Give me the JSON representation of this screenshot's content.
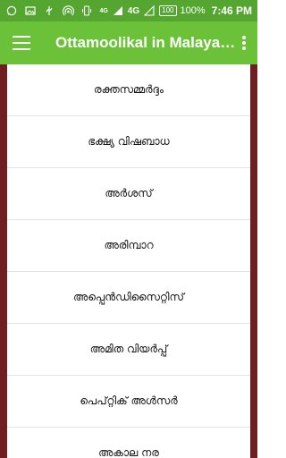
{
  "status_bar": {
    "network_4g_small": "4G",
    "network_4g": "4G",
    "battery_level": "100",
    "battery_percent": "100%",
    "time": "7:46 PM"
  },
  "app_bar": {
    "title": "Ottamoolikal in Malayalam"
  },
  "list": {
    "items": [
      {
        "label": "രക്തസമ്മർദ്ദം"
      },
      {
        "label": "ഭക്ഷ്യ വിഷബാധ"
      },
      {
        "label": "അർശസ്"
      },
      {
        "label": "അരിമ്പാറ"
      },
      {
        "label": "അപ്പെൻഡിസൈറ്റിസ്"
      },
      {
        "label": "അമിത വിയർപ്പ്"
      },
      {
        "label": "പെപ്റ്റിക് അൾസർ"
      },
      {
        "label": "അകാല നര"
      }
    ]
  },
  "colors": {
    "status_bar": "#54a630",
    "app_bar": "#6bc238",
    "frame": "#6e1f1f"
  }
}
